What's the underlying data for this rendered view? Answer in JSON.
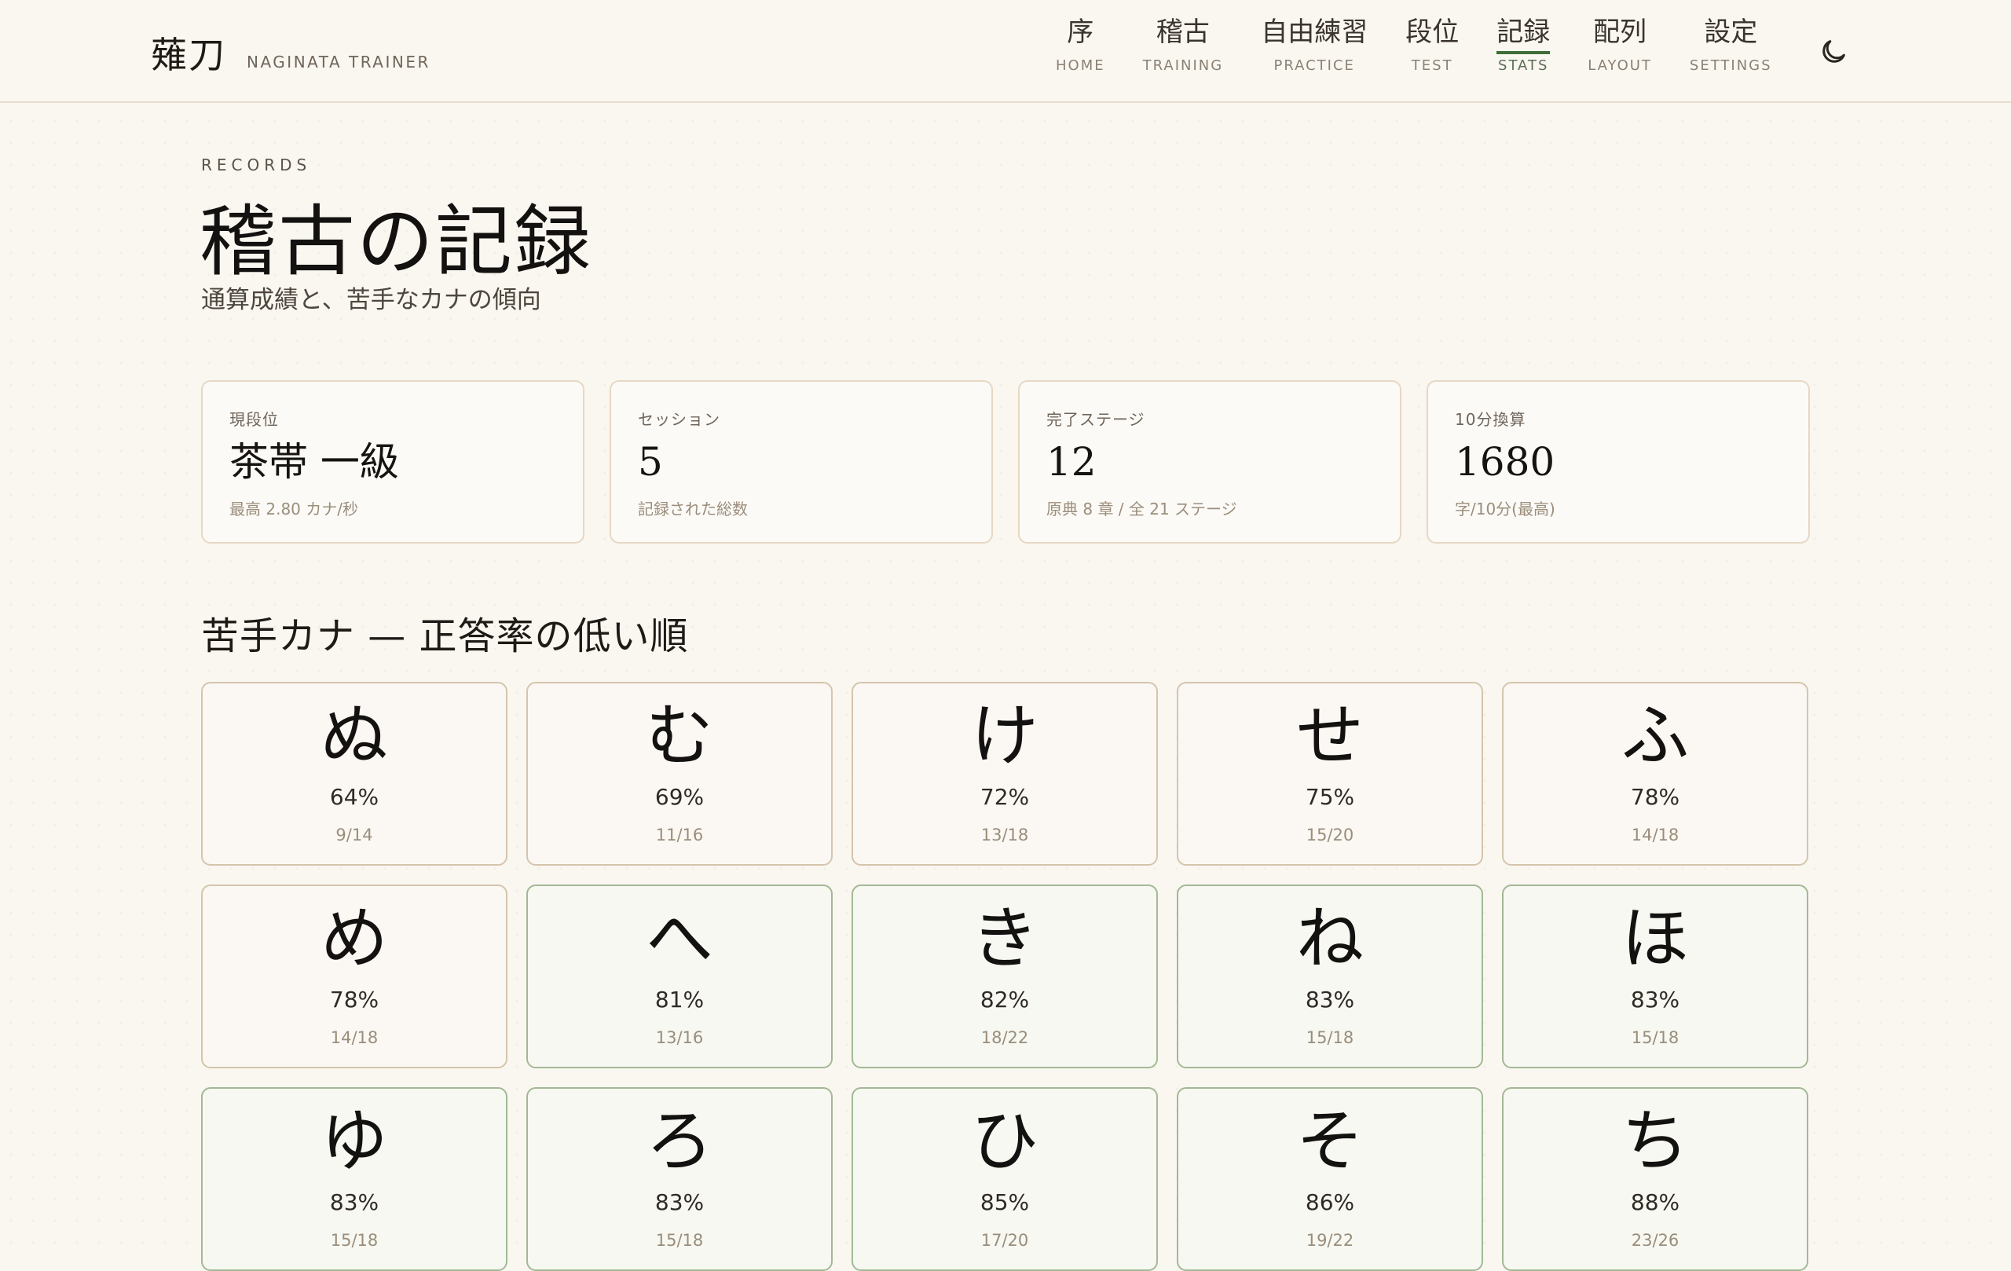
{
  "header": {
    "brand_kanji": "薙刀",
    "brand_sub": "NAGINATA TRAINER",
    "nav": [
      {
        "jp": "序",
        "en": "HOME",
        "active": false
      },
      {
        "jp": "稽古",
        "en": "TRAINING",
        "active": false
      },
      {
        "jp": "自由練習",
        "en": "PRACTICE",
        "active": false
      },
      {
        "jp": "段位",
        "en": "TEST",
        "active": false
      },
      {
        "jp": "記録",
        "en": "STATS",
        "active": true
      },
      {
        "jp": "配列",
        "en": "LAYOUT",
        "active": false
      },
      {
        "jp": "設定",
        "en": "SETTINGS",
        "active": false
      }
    ],
    "theme_icon": "moon-icon"
  },
  "main": {
    "eyebrow": "RECORDS",
    "title": "稽古の記録",
    "subtitle": "通算成績と、苦手なカナの傾向",
    "stats": [
      {
        "label": "現段位",
        "value": "茶帯 一級",
        "note": "最高 2.80 カナ/秒"
      },
      {
        "label": "セッション",
        "value": "5",
        "note": "記録された総数"
      },
      {
        "label": "完了ステージ",
        "value": "12",
        "note": "原典 8 章 / 全 21 ステージ"
      },
      {
        "label": "10分換算",
        "value": "1680",
        "note": "字/10分(最高)"
      }
    ],
    "weak_section_title": "苦手カナ — 正答率の低い順",
    "weak_kana": [
      {
        "kana": "ぬ",
        "pct": "64%",
        "frac": "9/14"
      },
      {
        "kana": "む",
        "pct": "69%",
        "frac": "11/16"
      },
      {
        "kana": "け",
        "pct": "72%",
        "frac": "13/18"
      },
      {
        "kana": "せ",
        "pct": "75%",
        "frac": "15/20"
      },
      {
        "kana": "ふ",
        "pct": "78%",
        "frac": "14/18"
      },
      {
        "kana": "め",
        "pct": "78%",
        "frac": "14/18"
      },
      {
        "kana": "へ",
        "pct": "81%",
        "frac": "13/16"
      },
      {
        "kana": "き",
        "pct": "82%",
        "frac": "18/22"
      },
      {
        "kana": "ね",
        "pct": "83%",
        "frac": "15/18"
      },
      {
        "kana": "ほ",
        "pct": "83%",
        "frac": "15/18"
      },
      {
        "kana": "ゆ",
        "pct": "83%",
        "frac": "15/18"
      },
      {
        "kana": "ろ",
        "pct": "83%",
        "frac": "15/18"
      },
      {
        "kana": "ひ",
        "pct": "85%",
        "frac": "17/20"
      },
      {
        "kana": "そ",
        "pct": "86%",
        "frac": "19/22"
      },
      {
        "kana": "ち",
        "pct": "88%",
        "frac": "23/26"
      }
    ]
  },
  "colors": {
    "background": "#faf7f1",
    "accent": "#3f6e37",
    "weak_border": "#d4c5ad",
    "mid_border": "#a3b896"
  }
}
